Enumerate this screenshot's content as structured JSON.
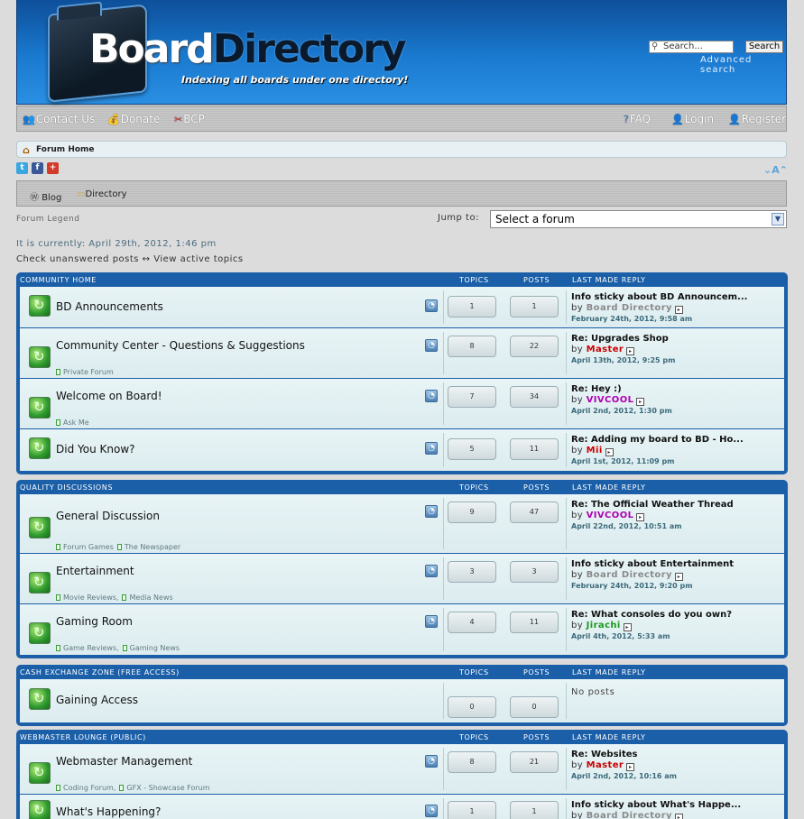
{
  "header": {
    "logo_board": "Board",
    "logo_directory": "Directory",
    "tagline": "Indexing all boards under one directory!",
    "search_placeholder": "Search...",
    "search_button": "Search",
    "advanced_search": "Advanced search"
  },
  "nav": {
    "left": [
      "Contact Us",
      "Donate",
      "BCP"
    ],
    "right": [
      "FAQ",
      "Login",
      "Register"
    ]
  },
  "breadcrumb": "Forum Home",
  "font_size_control": "A",
  "subnav": [
    "Blog",
    "Directory"
  ],
  "forum_legend": "Forum Legend",
  "jump_to": {
    "label": "Jump to:",
    "selected": "Select a forum"
  },
  "current_time": "It is currently: April 29th, 2012, 1:46 pm",
  "quick_links": "Check unanswered posts ↔ View active topics",
  "col_headers": {
    "topics": "TOPICS",
    "posts": "POSTS",
    "last": "LAST MADE REPLY"
  },
  "categories": [
    {
      "name": "COMMUNITY HOME",
      "forums": [
        {
          "title": "BD Announcements",
          "subforums": "",
          "topics": "1",
          "posts": "1",
          "last_title": "Info sticky about BD Announcem...",
          "last_user": "Board Directory",
          "user_color": "#8a8a8a",
          "last_date": "February 24th, 2012, 9:58 am"
        },
        {
          "title": "Community Center - Questions & Suggestions",
          "subforums": "Private Forum",
          "topics": "8",
          "posts": "22",
          "last_title": "Re: Upgrades Shop",
          "last_user": "Master",
          "user_color": "#cc0000",
          "last_date": "April 13th, 2012, 9:25 pm"
        },
        {
          "title": "Welcome on Board!",
          "subforums": "Ask Me",
          "topics": "7",
          "posts": "34",
          "last_title": "Re: Hey :)",
          "last_user": "VIVCOOL",
          "user_color": "#b000b0",
          "last_date": "April 2nd, 2012, 1:30 pm"
        },
        {
          "title": "Did You Know?",
          "subforums": "",
          "topics": "5",
          "posts": "11",
          "last_title": "Re: Adding my board to BD - Ho...",
          "last_user": "Mii",
          "user_color": "#cc0000",
          "last_date": "April 1st, 2012, 11:09 pm"
        }
      ]
    },
    {
      "name": "QUALITY DISCUSSIONS",
      "forums": [
        {
          "title": "General Discussion",
          "subforums": "Forum Games|The Newspaper",
          "topics": "9",
          "posts": "47",
          "last_title": "Re: The Official Weather Thread",
          "last_user": "VIVCOOL",
          "user_color": "#b000b0",
          "last_date": "April 22nd, 2012, 10:51 am"
        },
        {
          "title": "Entertainment",
          "subforums": "Movie Reviews,|Media News",
          "topics": "3",
          "posts": "3",
          "last_title": "Info sticky about Entertainment",
          "last_user": "Board Directory",
          "user_color": "#8a8a8a",
          "last_date": "February 24th, 2012, 9:20 pm"
        },
        {
          "title": "Gaming Room",
          "subforums": "Game Reviews,|Gaming News",
          "topics": "4",
          "posts": "11",
          "last_title": "Re: What consoles do you own?",
          "last_user": "Jirachi",
          "user_color": "#1a9a1a",
          "last_date": "April 4th, 2012, 5:33 am"
        }
      ]
    },
    {
      "name": "CASH EXCHANGE ZONE (FREE ACCESS)",
      "forums": [
        {
          "title": "Gaining Access",
          "subforums": "",
          "topics": "0",
          "posts": "0",
          "no_posts": "No posts"
        }
      ]
    },
    {
      "name": "WEBMASTER LOUNGE (PUBLIC)",
      "forums": [
        {
          "title": "Webmaster Management",
          "subforums": "Coding Forum,|GFX - Showcase Forum",
          "topics": "8",
          "posts": "21",
          "last_title": "Re: Websites",
          "last_user": "Master",
          "user_color": "#cc0000",
          "last_date": "April 2nd, 2012, 10:16 am"
        },
        {
          "title": "What's Happening?",
          "subforums": "",
          "topics": "1",
          "posts": "1",
          "last_title": "Info sticky about What's Happe...",
          "last_user": "Board Directory",
          "user_color": "#8a8a8a",
          "last_date": ""
        }
      ]
    }
  ],
  "by_label": "by"
}
